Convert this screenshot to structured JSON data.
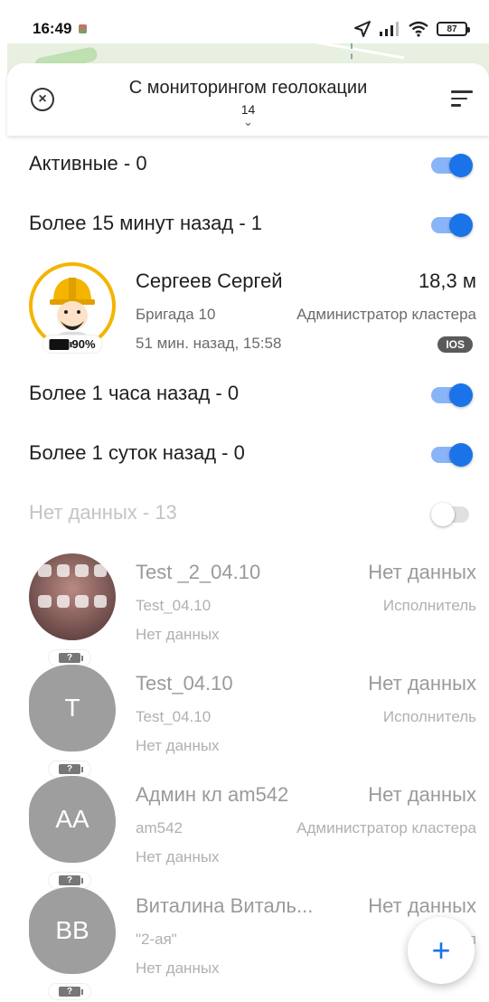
{
  "status_bar": {
    "time": "16:49",
    "battery": "87"
  },
  "header": {
    "title": "С мониторингом геолокации",
    "count": "14",
    "chevron": "⌄"
  },
  "groups": [
    {
      "label": "Активные - 0",
      "enabled": true
    },
    {
      "label": "Более 15 минут назад - 1",
      "enabled": true
    },
    {
      "label": "Более 1 часа назад - 0",
      "enabled": true
    },
    {
      "label": "Более 1 суток назад - 0",
      "enabled": true
    },
    {
      "label": "Нет данных - 13",
      "enabled": false
    }
  ],
  "users": [
    {
      "name": "Сергеев Сергей",
      "distance": "18,3 м",
      "team": "Бригада 10",
      "role": "Администратор кластера",
      "last_seen": "51 мин. назад, 15:58",
      "battery": "90%",
      "platform": "IOS"
    },
    {
      "name": "Test _2_04.10",
      "distance": "Нет данных",
      "team": "Test_04.10",
      "role": "Исполнитель",
      "last_seen": "Нет данных",
      "battery": "?"
    },
    {
      "name": "Test_04.10",
      "initials": "T",
      "distance": "Нет данных",
      "team": "Test_04.10",
      "role": "Исполнитель",
      "last_seen": "Нет данных",
      "battery": "?"
    },
    {
      "name": "Админ  кл am542",
      "initials": "AA",
      "distance": "Нет данных",
      "team": "am542",
      "role": "Администратор кластера",
      "last_seen": "Нет данных",
      "battery": "?"
    },
    {
      "name": "Виталина Виталь...",
      "initials": "BB",
      "distance": "Нет данных",
      "team": "\"2-ая\"",
      "role": "Испол",
      "last_seen": "Нет данных",
      "battery": "?"
    }
  ],
  "fab": {
    "label": "+"
  },
  "icons": {
    "close": "close-circle-icon",
    "sort": "sort-icon",
    "location": "location-arrow-icon",
    "signal": "signal-icon",
    "wifi": "wifi-icon",
    "battery": "battery-icon",
    "add": "plus-icon"
  },
  "colors": {
    "accent": "#1a73e8",
    "toggle_track": "#8ab4f8",
    "worker_ring": "#f5b400",
    "avatar_grey": "#9e9e9e"
  }
}
